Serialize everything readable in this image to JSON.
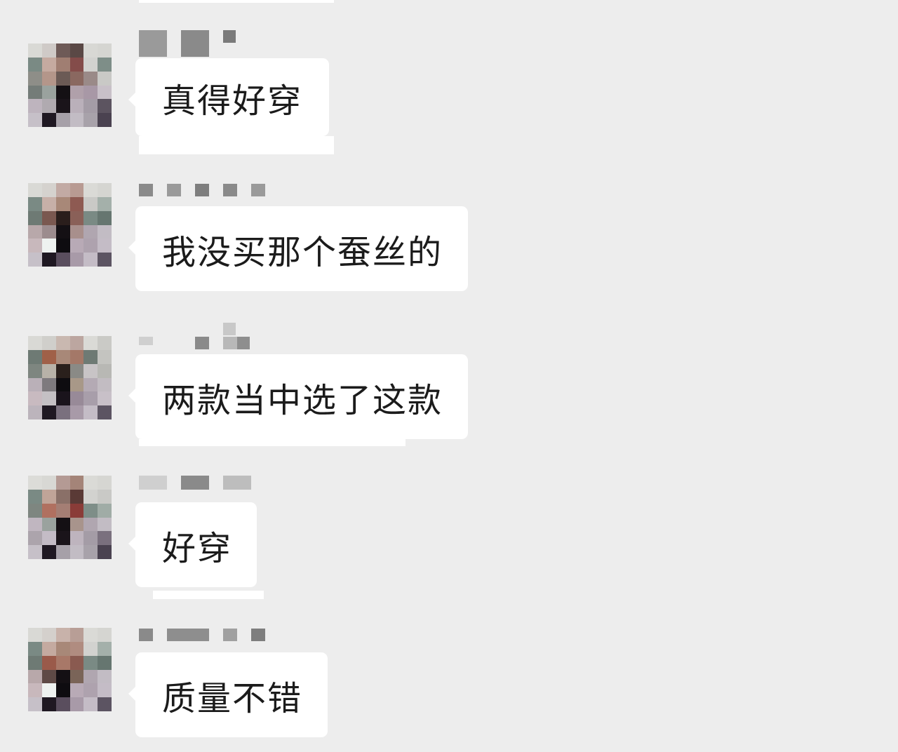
{
  "messages": [
    {
      "text": "真得好穿",
      "avatar_icon": "pixelated-avatar-icon",
      "sender": "redacted"
    },
    {
      "text": "我没买那个蚕丝的",
      "avatar_icon": "pixelated-avatar-icon",
      "sender": "redacted"
    },
    {
      "text": "两款当中选了这款",
      "avatar_icon": "pixelated-avatar-icon",
      "sender": "redacted"
    },
    {
      "text": "好穿",
      "avatar_icon": "pixelated-avatar-icon",
      "sender": "redacted"
    },
    {
      "text": "质量不错",
      "avatar_icon": "pixelated-avatar-icon",
      "sender": "redacted"
    }
  ],
  "colors": {
    "background": "#ededed",
    "bubble": "#ffffff",
    "text": "#1b1b1b",
    "redaction": "#8c8c8c"
  }
}
